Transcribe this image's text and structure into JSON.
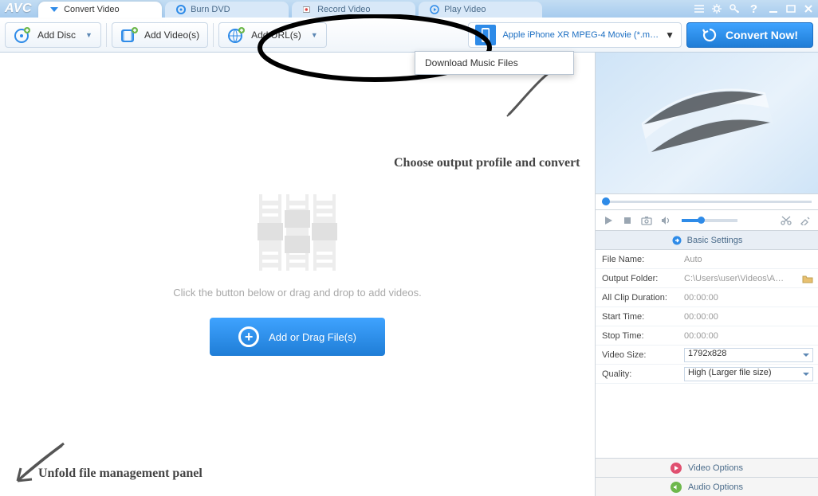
{
  "app": {
    "logo": "AVC"
  },
  "tabs": [
    {
      "label": "Convert Video",
      "icon": "convert"
    },
    {
      "label": "Burn DVD",
      "icon": "disc"
    },
    {
      "label": "Record Video",
      "icon": "record"
    },
    {
      "label": "Play Video",
      "icon": "play"
    }
  ],
  "toolbar": {
    "add_disc": "Add Disc",
    "add_videos": "Add Video(s)",
    "add_url": "Add URL(s)",
    "profile": "Apple iPhone XR MPEG-4 Movie (*.m…",
    "convert": "Convert Now!"
  },
  "url_dropdown": {
    "download_music": "Download Music Files"
  },
  "main": {
    "hint": "Click the button below or drag and drop to add videos.",
    "add_button": "Add or Drag File(s)"
  },
  "sidebar": {
    "basic_settings_hdr": "Basic Settings",
    "fields": {
      "file_name_k": "File Name:",
      "file_name_v": "Auto",
      "output_folder_k": "Output Folder:",
      "output_folder_v": "C:\\Users\\user\\Videos\\A…",
      "all_clip_k": "All Clip Duration:",
      "all_clip_v": "00:00:00",
      "start_time_k": "Start Time:",
      "start_time_v": "00:00:00",
      "stop_time_k": "Stop Time:",
      "stop_time_v": "00:00:00",
      "video_size_k": "Video Size:",
      "video_size_v": "1792x828",
      "quality_k": "Quality:",
      "quality_v": "High (Larger file size)"
    },
    "video_options": "Video Options",
    "audio_options": "Audio Options"
  },
  "annotations": {
    "choose": "Choose output profile and convert",
    "unfold": "Unfold file management panel"
  }
}
